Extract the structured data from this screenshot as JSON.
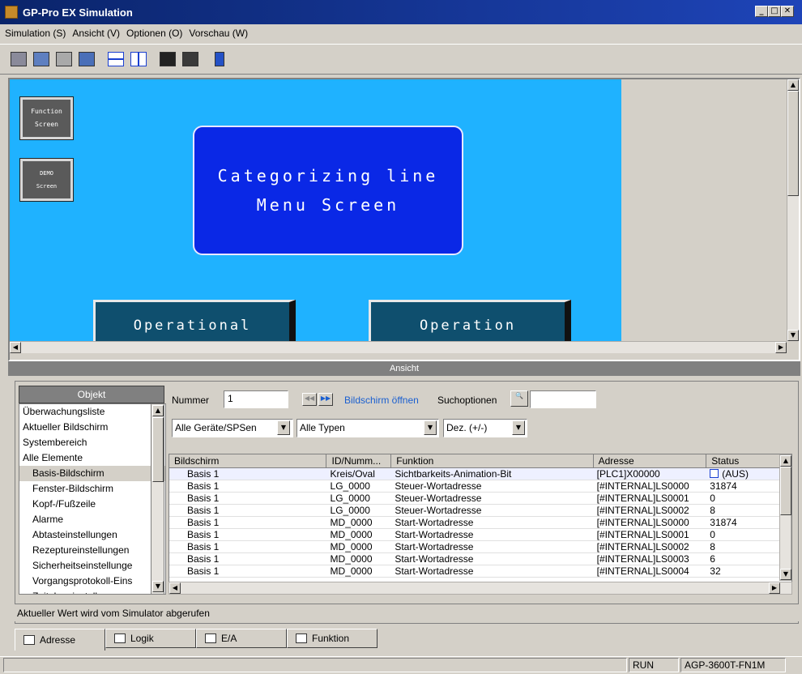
{
  "window": {
    "title": "GP-Pro EX Simulation"
  },
  "menu": [
    "Simulation (S)",
    "Ansicht (V)",
    "Optionen (O)",
    "Vorschau (W)"
  ],
  "toolbar": {
    "icons": [
      "monitor-icon",
      "device-icon",
      "io-icon",
      "function-icon",
      "split-horizontal-icon",
      "split-vertical-icon",
      "camera-icon",
      "tool-icon",
      "exit-icon"
    ]
  },
  "hmi": {
    "function_btn": [
      "Function",
      "Screen"
    ],
    "demo_btn": [
      "DEMO",
      "Screen"
    ],
    "title_lines": [
      "Categorizing line",
      "Menu Screen"
    ],
    "op1": "Operational",
    "op2": "Operation",
    "colors": {
      "background": "#1fb2ff",
      "title_box": "#0a28e6",
      "op_button": "#0f4f6e"
    }
  },
  "ansicht": {
    "label": "Ansicht"
  },
  "objekt": {
    "header": "Objekt",
    "items": [
      {
        "label": "Überwachungsliste",
        "indent": false
      },
      {
        "label": "Aktueller Bildschirm",
        "indent": false
      },
      {
        "label": "Systembereich",
        "indent": false
      },
      {
        "label": "Alle Elemente",
        "indent": false
      },
      {
        "label": "Basis-Bildschirm",
        "indent": true
      },
      {
        "label": "Fenster-Bildschirm",
        "indent": true
      },
      {
        "label": "Kopf-/Fußzeile",
        "indent": true
      },
      {
        "label": "Alarme",
        "indent": true
      },
      {
        "label": "Abtasteinstellungen",
        "indent": true
      },
      {
        "label": "Rezeptureinstellungen",
        "indent": true
      },
      {
        "label": "Sicherheitseinstellunge",
        "indent": true
      },
      {
        "label": "Vorgangsprotokoll-Eins",
        "indent": true
      },
      {
        "label": "Zeitplaneinstellungen",
        "indent": true
      }
    ]
  },
  "filters": {
    "nummer_label": "Nummer",
    "nummer_value": "1",
    "open_link": "Bildschirm öffnen",
    "search_label": "Suchoptionen",
    "search_value": "",
    "devices": "Alle Geräte/SPSen",
    "types": "Alle Typen",
    "format": "Dez. (+/-)"
  },
  "table": {
    "columns": [
      "Bildschirm",
      "ID/Numm...",
      "Funktion",
      "Adresse",
      "Status"
    ],
    "rows": [
      [
        "Basis 1",
        "Kreis/Oval",
        "Sichtbarkeits-Animation-Bit",
        "[PLC1]X00000",
        "(AUS)"
      ],
      [
        "Basis 1",
        "LG_0000",
        "Steuer-Wortadresse",
        "[#INTERNAL]LS0000",
        "31874"
      ],
      [
        "Basis 1",
        "LG_0000",
        "Steuer-Wortadresse",
        "[#INTERNAL]LS0001",
        "0"
      ],
      [
        "Basis 1",
        "LG_0000",
        "Steuer-Wortadresse",
        "[#INTERNAL]LS0002",
        "8"
      ],
      [
        "Basis 1",
        "MD_0000",
        "Start-Wortadresse",
        "[#INTERNAL]LS0000",
        "31874"
      ],
      [
        "Basis 1",
        "MD_0000",
        "Start-Wortadresse",
        "[#INTERNAL]LS0001",
        "0"
      ],
      [
        "Basis 1",
        "MD_0000",
        "Start-Wortadresse",
        "[#INTERNAL]LS0002",
        "8"
      ],
      [
        "Basis 1",
        "MD_0000",
        "Start-Wortadresse",
        "[#INTERNAL]LS0003",
        "6"
      ],
      [
        "Basis 1",
        "MD_0000",
        "Start-Wortadresse",
        "[#INTERNAL]LS0004",
        "32"
      ]
    ]
  },
  "status_message": "Aktueller Wert wird vom Simulator abgerufen",
  "tabs": [
    "Adresse",
    "Logik",
    "E/A",
    "Funktion"
  ],
  "statusbar": {
    "state": "RUN",
    "model": "AGP-3600T-FN1M"
  }
}
